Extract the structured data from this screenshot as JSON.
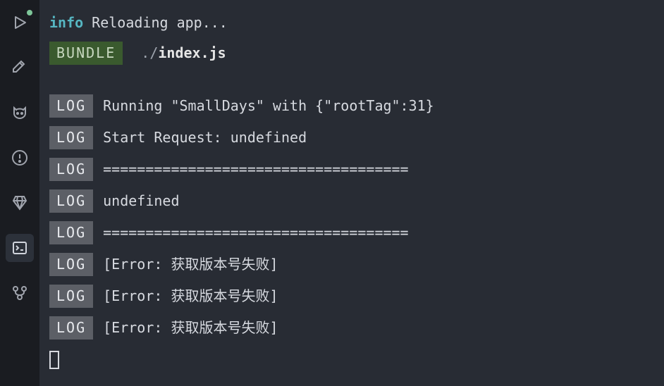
{
  "sidebar": {
    "icons": [
      "play",
      "hammer",
      "cat",
      "alert",
      "diamond",
      "terminal",
      "branch"
    ]
  },
  "terminal": {
    "info_label": "info",
    "info_text": "Reloading app...",
    "bundle_label": "BUNDLE",
    "bundle_path_prefix": " ./",
    "bundle_file": "index.js",
    "log_label": "LOG",
    "logs": [
      "Running \"SmallDays\" with {\"rootTag\":31}",
      "Start Request: undefined",
      "====================================",
      "undefined",
      "====================================",
      "[Error: 获取版本号失败]",
      "[Error: 获取版本号失败]",
      "[Error: 获取版本号失败]"
    ]
  }
}
